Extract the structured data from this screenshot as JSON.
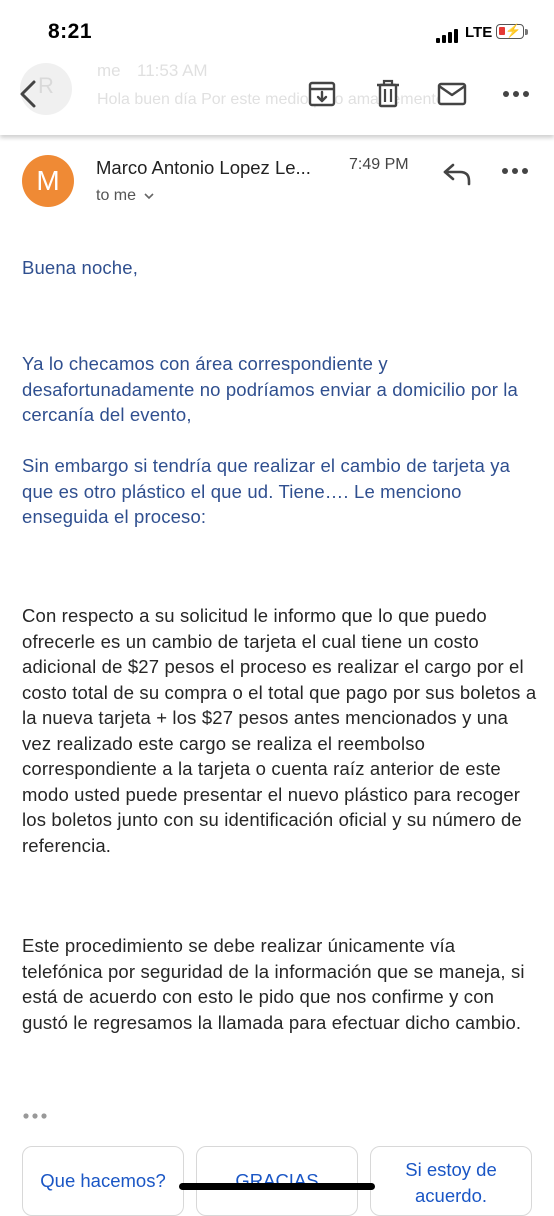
{
  "status_bar": {
    "time": "8:21",
    "network": "LTE"
  },
  "toolbar": {
    "ghost_sender": "me",
    "ghost_time": "11:53 AM",
    "ghost_initial": "R",
    "ghost_snippet": "Hola buen día Por este medio pido amablemente ar",
    "icons": [
      "back-icon",
      "archive-icon",
      "delete-icon",
      "mark-unread-icon",
      "more-icon"
    ]
  },
  "email": {
    "avatar_letter": "M",
    "avatar_color": "#ef8a35",
    "sender": "Marco Antonio Lopez Le...",
    "time": "7:49 PM",
    "recipient": "to me",
    "greeting": "Buena noche,",
    "paragraph_1": "Ya lo checamos con área correspondiente y desafortunadamente no podríamos enviar a domicilio por la cercanía del evento,",
    "paragraph_2": "Sin embargo si tendría que realizar el cambio de tarjeta ya que es otro plástico el que ud. Tiene…. Le menciono enseguida el proceso:",
    "paragraph_3": "Con respecto a su solicitud le informo que lo que puedo ofrecerle es un cambio de tarjeta el cual tiene un costo adicional de $27 pesos el proceso es realizar el cargo por el costo total de su compra o el total que pago por sus boletos a la nueva tarjeta + los $27 pesos antes mencionados y una vez realizado este cargo se realiza el reembolso correspondiente a la tarjeta o cuenta raíz anterior de este modo usted puede presentar el nuevo plástico para recoger los boletos junto con su identificación oficial y su número de referencia.",
    "paragraph_4": "Este procedimiento se debe realizar únicamente vía telefónica por seguridad de la información que se maneja, si está de acuerdo con esto le pido que nos confirme y con gustó le regresamos la llamada para efectuar dicho cambio."
  },
  "smart_replies": [
    "Que hacemos?",
    "GRACIAS",
    "Si estoy de acuerdo."
  ],
  "colors": {
    "link_blue": "#1a56c5",
    "quoted_blue": "#2f4f8f"
  }
}
